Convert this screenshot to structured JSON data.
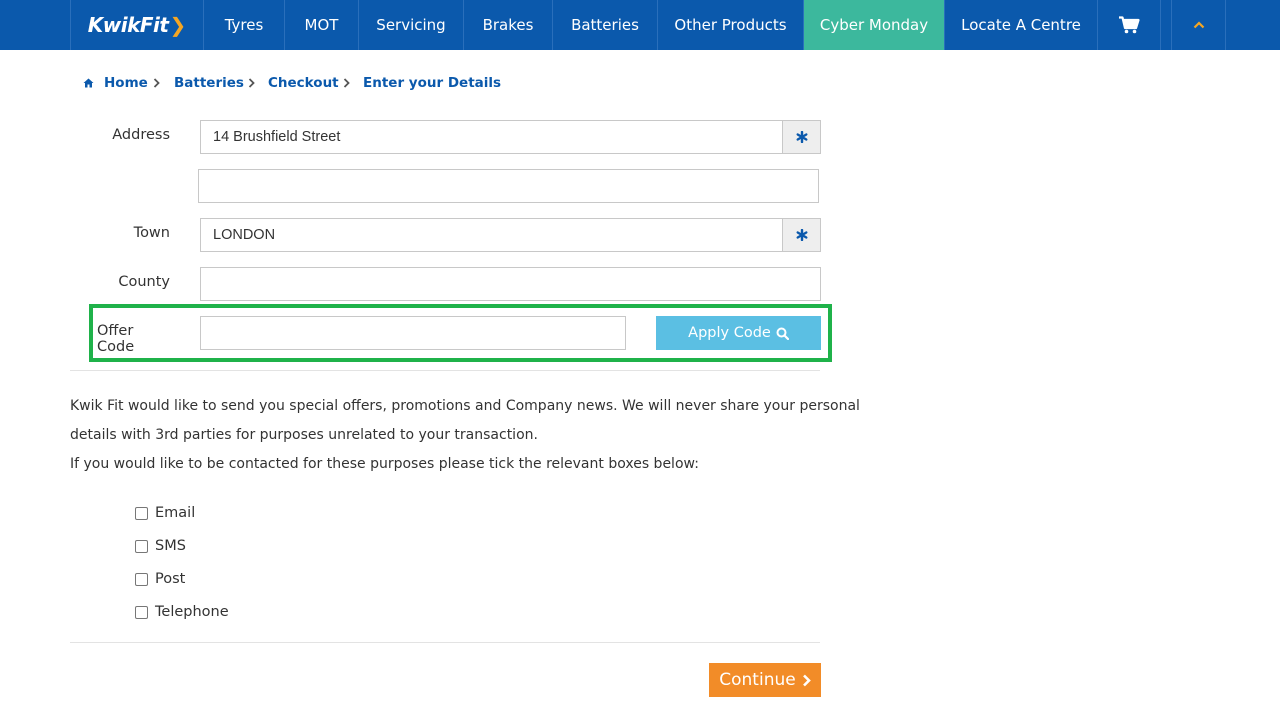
{
  "nav": {
    "logo_text": "KwikFit",
    "items": [
      {
        "label": "Tyres"
      },
      {
        "label": "MOT"
      },
      {
        "label": "Servicing"
      },
      {
        "label": "Brakes"
      },
      {
        "label": "Batteries"
      },
      {
        "label": "Other Products"
      },
      {
        "label": "Cyber Monday"
      },
      {
        "label": "Locate A Centre"
      }
    ],
    "active": "Cyber Monday",
    "cart_icon": "cart-icon",
    "toggle_icon": "chevron-up-icon"
  },
  "breadcrumb": [
    {
      "label": "Home",
      "icon": "home-icon"
    },
    {
      "label": "Batteries"
    },
    {
      "label": "Checkout"
    },
    {
      "label": "Enter your Details"
    }
  ],
  "form": {
    "address_label": "Address",
    "address_line1": "14 Brushfield Street",
    "address_line2": "",
    "town_label": "Town",
    "town": "LONDON",
    "county_label": "County",
    "county": "",
    "offer_label": "Offer Code",
    "offer_code": "",
    "apply_label": "Apply Code",
    "required_icon": "asterisk-icon"
  },
  "consent": {
    "line1": "Kwik Fit would like to send you special offers, promotions and Company news. We will never share your personal",
    "line2": "details with 3rd parties for purposes unrelated to your transaction.",
    "line3": "If you would like to be contacted for these purposes please tick the relevant boxes below:",
    "options": [
      {
        "label": "Email",
        "checked": false
      },
      {
        "label": "SMS",
        "checked": false
      },
      {
        "label": "Post",
        "checked": false
      },
      {
        "label": "Telephone",
        "checked": false
      }
    ]
  },
  "continue_label": "Continue",
  "colors": {
    "nav_bg": "#0b59ac",
    "nav_active": "#3cb89d",
    "accent_orange": "#f28c28",
    "apply_blue": "#5bbfe3",
    "highlight_green": "#1fb24a"
  }
}
